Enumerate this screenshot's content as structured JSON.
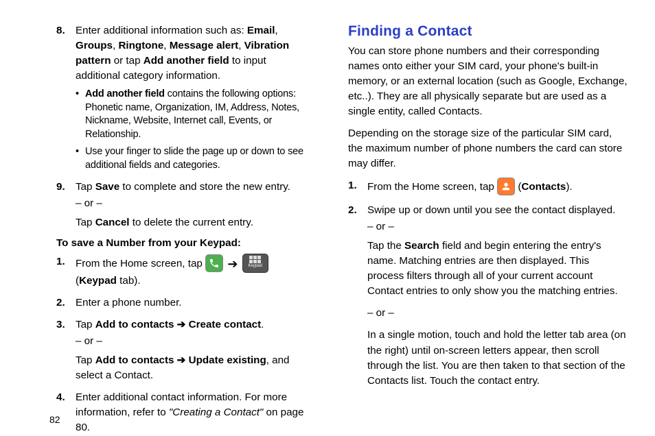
{
  "left": {
    "items": [
      {
        "num": "8.",
        "segments_pre": "Enter additional information such as: ",
        "bold1": "Email",
        "sep1": ", ",
        "bold2": "Groups",
        "sep2": ", ",
        "bold3": "Ringtone",
        "sep3": ", ",
        "bold4": "Message alert",
        "sep4": ", ",
        "bold5": "Vibration pattern",
        "sep5": " or tap ",
        "bold6": "Add another field",
        "post": " to input additional category information.",
        "bullets": [
          {
            "b": "Add another field",
            "rest": " contains the following options: Phonetic name, Organization, IM, Address, Notes, Nickname, Website, Internet call, Events, or Relationship."
          },
          {
            "b": "",
            "rest": "Use your finger to slide the page up or down to see additional fields and categories."
          }
        ]
      },
      {
        "num": "9.",
        "pre": "Tap ",
        "bold1": "Save",
        "post": " to complete and store the new entry.",
        "or": "– or –",
        "pre2": "Tap ",
        "bold2": "Cancel",
        "post2": " to delete the current entry."
      }
    ],
    "subhead": "To save a Number from your Keypad:",
    "keypad_items": [
      {
        "num": "1.",
        "pre": "From the Home screen, tap ",
        "arrow": "➔",
        "keypad_label": "Keypad",
        "post_open": " (",
        "bold_tab": "Keypad",
        "post": " tab)."
      },
      {
        "num": "2.",
        "text": "Enter a phone number."
      },
      {
        "num": "3.",
        "pre": "Tap ",
        "bold1": "Add to contacts ➔ Create contact",
        "post": ".",
        "or": "– or –",
        "pre2": "Tap ",
        "bold2": "Add to contacts ➔ Update existing",
        "post2": ", and select a Contact."
      },
      {
        "num": "4.",
        "pre": "Enter additional contact information. For more information, refer to ",
        "italic": "\"Creating a Contact\"",
        "post": "  on page 80."
      }
    ]
  },
  "right": {
    "title": "Finding a Contact",
    "p1": "You can store phone numbers and their corresponding names onto either your SIM card, your phone's built-in memory, or an external location (such as Google, Exchange, etc..). They are all physically separate but are used as a single entity, called Contacts.",
    "p2": "Depending on the storage size of the particular SIM card, the maximum number of phone numbers the card can store may differ.",
    "items": [
      {
        "num": "1.",
        "pre": "From the Home screen, tap ",
        "post_open": " (",
        "bold": "Contacts",
        "post": ")."
      },
      {
        "num": "2.",
        "line1": "Swipe up or down until you see the contact displayed.",
        "or1": "– or –",
        "line2_pre": "Tap the ",
        "line2_bold": "Search",
        "line2_post": " field and begin entering the entry's name. Matching entries are then displayed. This process filters through all of your current account Contact entries to only show you the matching entries.",
        "or2": "– or –",
        "line3": "In a single motion, touch and hold the letter tab area (on the right) until on-screen letters appear, then scroll through the list. You are then taken to that section of the Contacts list. Touch the contact entry."
      }
    ]
  },
  "page_num": "82"
}
